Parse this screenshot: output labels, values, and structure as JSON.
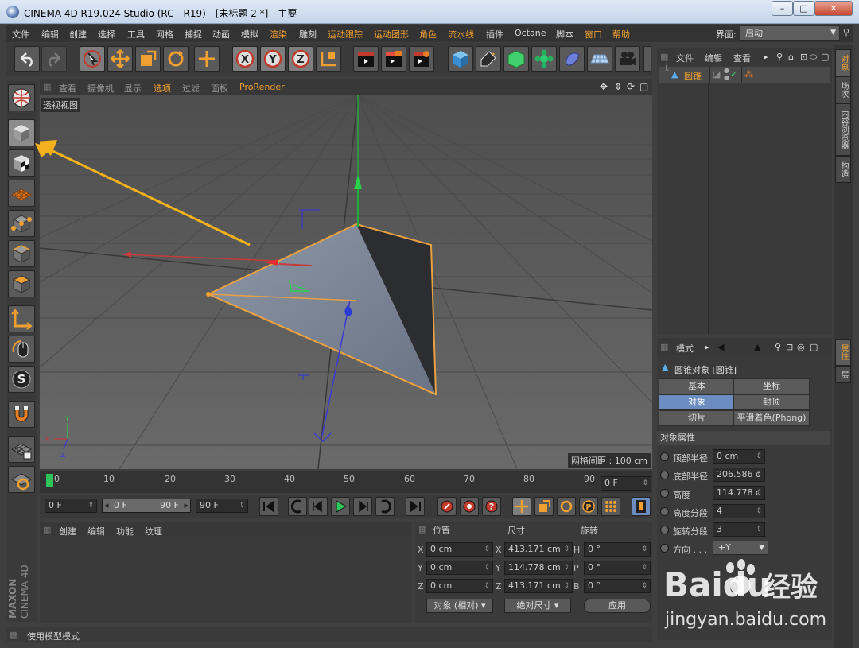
{
  "window": {
    "title": "CINEMA 4D R19.024 Studio (RC - R19) - [未标题 2 *] - 主要",
    "min": "–",
    "max": "□",
    "close": "✕"
  },
  "menu": [
    {
      "label": "文件"
    },
    {
      "label": "编辑"
    },
    {
      "label": "创建"
    },
    {
      "label": "选择"
    },
    {
      "label": "工具"
    },
    {
      "label": "网格"
    },
    {
      "label": "捕捉"
    },
    {
      "label": "动画"
    },
    {
      "label": "模拟"
    },
    {
      "label": "渲染"
    },
    {
      "label": "雕刻"
    },
    {
      "label": "运动跟踪"
    },
    {
      "label": "运动图形"
    },
    {
      "label": "角色"
    },
    {
      "label": "流水线"
    },
    {
      "label": "插件"
    },
    {
      "label": "Octane"
    },
    {
      "label": "脚本"
    },
    {
      "label": "窗口"
    },
    {
      "label": "帮助"
    }
  ],
  "layout": {
    "label": "界面:",
    "value": "启动"
  },
  "viewport": {
    "menu": [
      "查看",
      "摄像机",
      "显示",
      "选项",
      "过滤",
      "面板",
      "ProRender"
    ],
    "label": "透视视图",
    "grid_spacing": "网格间距 : 100 cm",
    "axis_x": "X",
    "axis_y": "Y",
    "axis_z": "Z"
  },
  "timeline": {
    "ticks": [
      "0",
      "10",
      "20",
      "30",
      "40",
      "50",
      "60",
      "70",
      "80",
      "90"
    ],
    "current_frame": "0 F"
  },
  "playback": {
    "start": "0 F",
    "range_start": "0 F",
    "range_end": "90 F",
    "end": "90 F"
  },
  "material": {
    "menu": [
      "创建",
      "编辑",
      "功能",
      "纹理"
    ]
  },
  "coords": {
    "headers": {
      "pos": "位置",
      "size": "尺寸",
      "rot": "旋转"
    },
    "rows": [
      {
        "a1": "X",
        "p": "0 cm",
        "a2": "X",
        "s": "413.171 cm",
        "a3": "H",
        "r": "0 °"
      },
      {
        "a1": "Y",
        "p": "0 cm",
        "a2": "Y",
        "s": "114.778 cm",
        "a3": "P",
        "r": "0 °"
      },
      {
        "a1": "Z",
        "p": "0 cm",
        "a2": "Z",
        "s": "413.171 cm",
        "a3": "B",
        "r": "0 °"
      }
    ],
    "mode": "对象 (相对)",
    "size_mode": "绝对尺寸",
    "apply": "应用"
  },
  "status": "使用模型模式",
  "objects": {
    "menu": [
      "文件",
      "编辑",
      "查看"
    ],
    "item": "圆锥"
  },
  "attributes": {
    "mode_label": "模式",
    "title": "圆锥对象 [圆锥]",
    "tabs": [
      {
        "label": "基本"
      },
      {
        "label": "坐标"
      },
      {
        "label": "对象"
      },
      {
        "label": "封顶"
      },
      {
        "label": "切片"
      },
      {
        "label": "平滑着色(Phong)"
      }
    ],
    "section": "对象属性",
    "props": [
      {
        "label": "顶部半径",
        "value": "0 cm"
      },
      {
        "label": "底部半径",
        "value": "206.586 c"
      },
      {
        "label": "高度",
        "value": "114.778 c"
      },
      {
        "label": "高度分段",
        "value": "4"
      },
      {
        "label": "旋转分段",
        "value": "3"
      },
      {
        "label": "方向 . . .",
        "value": "+Y"
      }
    ]
  },
  "right_tabs": {
    "objects": "对象",
    "takes": "场次",
    "content": "内容浏览器",
    "structure": "构造",
    "attrs": "属性",
    "layers": "层"
  },
  "logo": {
    "maxon": "MAXON",
    "c4d": "CINEMA 4D"
  },
  "watermark": {
    "brand": "Baidu",
    "brand2": "经验",
    "url": "jingyan.baidu.com"
  }
}
